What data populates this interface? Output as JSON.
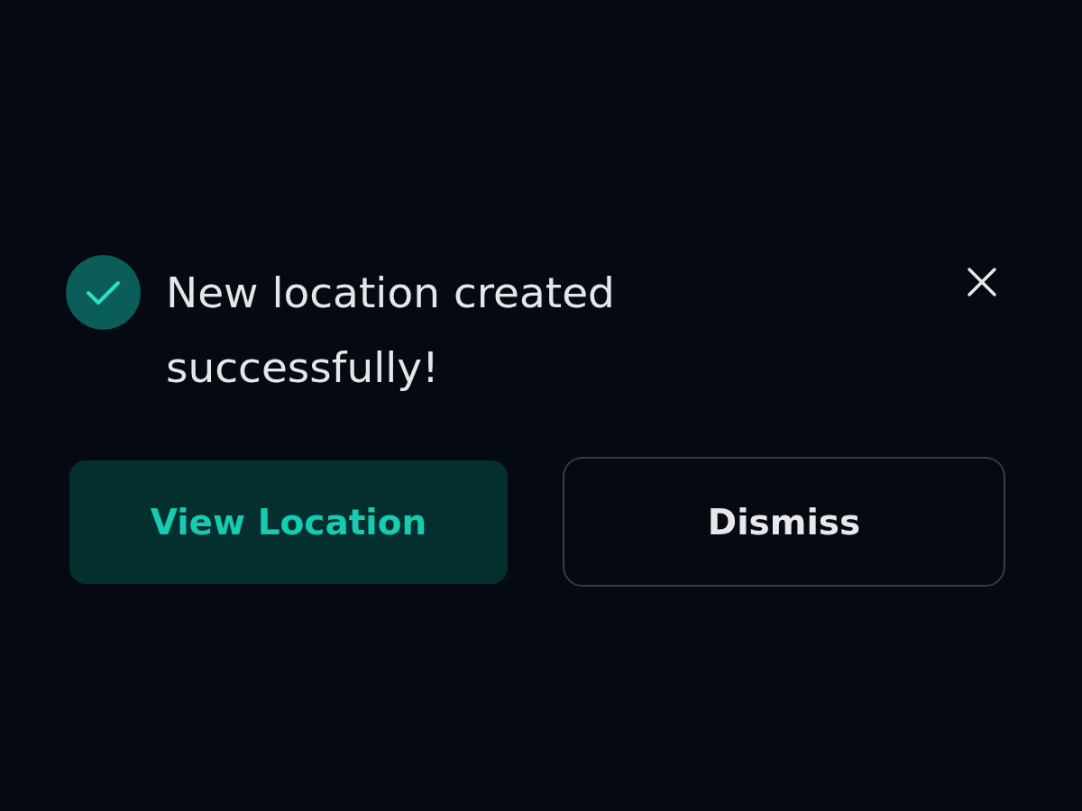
{
  "toast": {
    "success": true,
    "message": "New location created successfully!",
    "actions": [
      {
        "label": "View Location",
        "kind": "primary"
      },
      {
        "label": "Dismiss",
        "kind": "secondary"
      }
    ]
  }
}
